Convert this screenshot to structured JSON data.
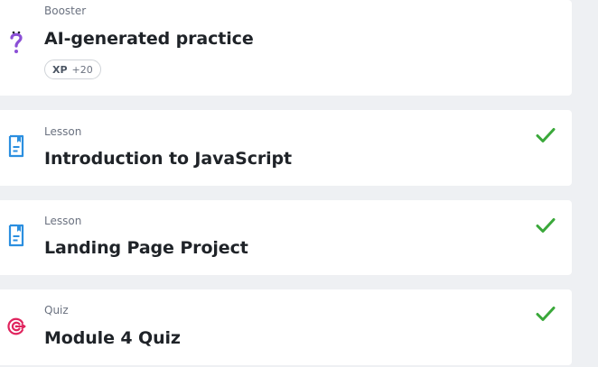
{
  "items": [
    {
      "type": "Booster",
      "title": "AI-generated practice",
      "icon": "question-mark-icon",
      "completed": false,
      "badge": {
        "label": "XP",
        "value": "+20"
      }
    },
    {
      "type": "Lesson",
      "title": "Introduction to JavaScript",
      "icon": "document-icon",
      "completed": true
    },
    {
      "type": "Lesson",
      "title": "Landing Page Project",
      "icon": "document-icon",
      "completed": true
    },
    {
      "type": "Quiz",
      "title": "Module 4 Quiz",
      "icon": "target-icon",
      "completed": true
    }
  ],
  "colors": {
    "background": "#eef0f3",
    "card": "#ffffff",
    "check": "#3aa83a",
    "lesson_icon": "#2b8fe0",
    "booster_icon": "#8b4fd6",
    "quiz_icon": "#e0245e"
  }
}
